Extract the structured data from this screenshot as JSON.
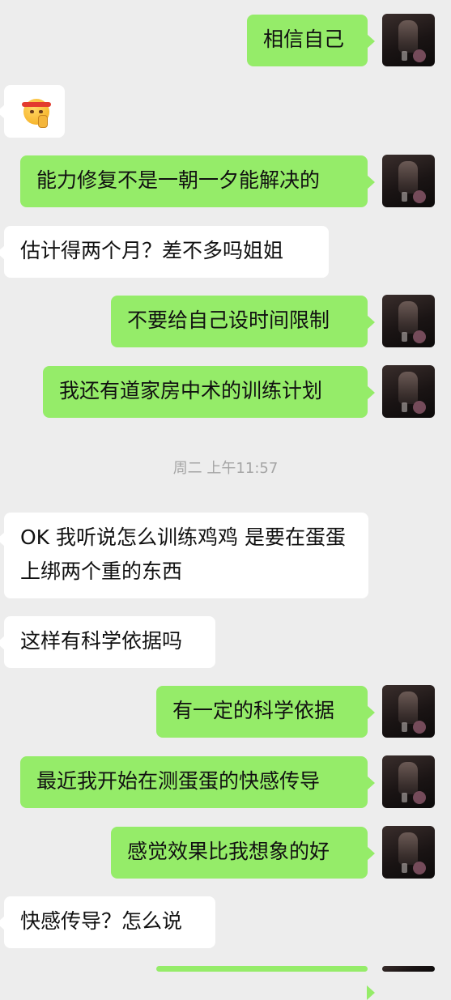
{
  "conversation": {
    "timestamp": "周二 上午11:57",
    "emoji": "shushing-face-emoji",
    "messages": [
      {
        "side": "out",
        "text": "相信自己"
      },
      {
        "side": "out",
        "text": "能力修复不是一朝一夕能解决的"
      },
      {
        "side": "in",
        "text": "估计得两个月？差不多吗姐姐"
      },
      {
        "side": "out",
        "text": "不要给自己设时间限制"
      },
      {
        "side": "out",
        "text": "我还有道家房中术的训练计划"
      },
      {
        "side": "in",
        "text": "OK 我听说怎么训练鸡鸡 是要在蛋蛋上绑两个重的东西"
      },
      {
        "side": "in",
        "text": "这样有科学依据吗"
      },
      {
        "side": "out",
        "text": "有一定的科学依据"
      },
      {
        "side": "out",
        "text": "最近我开始在测蛋蛋的快感传导"
      },
      {
        "side": "out",
        "text": "感觉效果比我想象的好"
      },
      {
        "side": "in",
        "text": "快感传导？怎么说"
      }
    ]
  },
  "colors": {
    "background": "#ededed",
    "outgoing_bubble": "#95ec69",
    "incoming_bubble": "#ffffff",
    "timestamp_text": "#a5a5a5"
  }
}
